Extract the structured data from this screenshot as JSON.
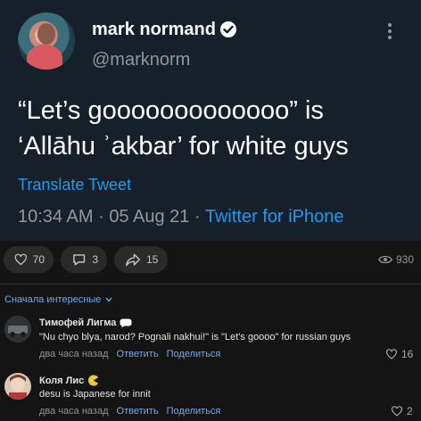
{
  "tweet": {
    "author_name": "mark normand",
    "handle": "@marknorm",
    "text_line1": "“Let’s gooooooooooooo” is",
    "text_line2": "‘Allāhu ʾakbar’ for white guys",
    "translate_label": "Translate Tweet",
    "time": "10:34 AM",
    "date": "05 Aug 21",
    "source": "Twitter for iPhone",
    "separator": "·"
  },
  "post_actions": {
    "likes": "70",
    "comments": "3",
    "shares": "15",
    "views": "930"
  },
  "comments_section": {
    "sort_label": "Сначала интересные",
    "comments": [
      {
        "author": "Тимофей Лигма",
        "text": "\"Nu chyo blya, narod? Pognali nakhui!\" is \"Let's goooo\" for russian guys",
        "time": "два часа назад",
        "reply": "Ответить",
        "share": "Поделиться",
        "likes": "16"
      },
      {
        "author": "Коля Лис",
        "text": "desu is Japanese for innit",
        "time": "два часа назад",
        "reply": "Ответить",
        "share": "Поделиться",
        "likes": "2"
      }
    ]
  },
  "colors": {
    "tweet_bg": "#15202b",
    "page_bg": "#141414",
    "link_blue": "#1d9bf0",
    "vk_link": "#71aaeb"
  }
}
